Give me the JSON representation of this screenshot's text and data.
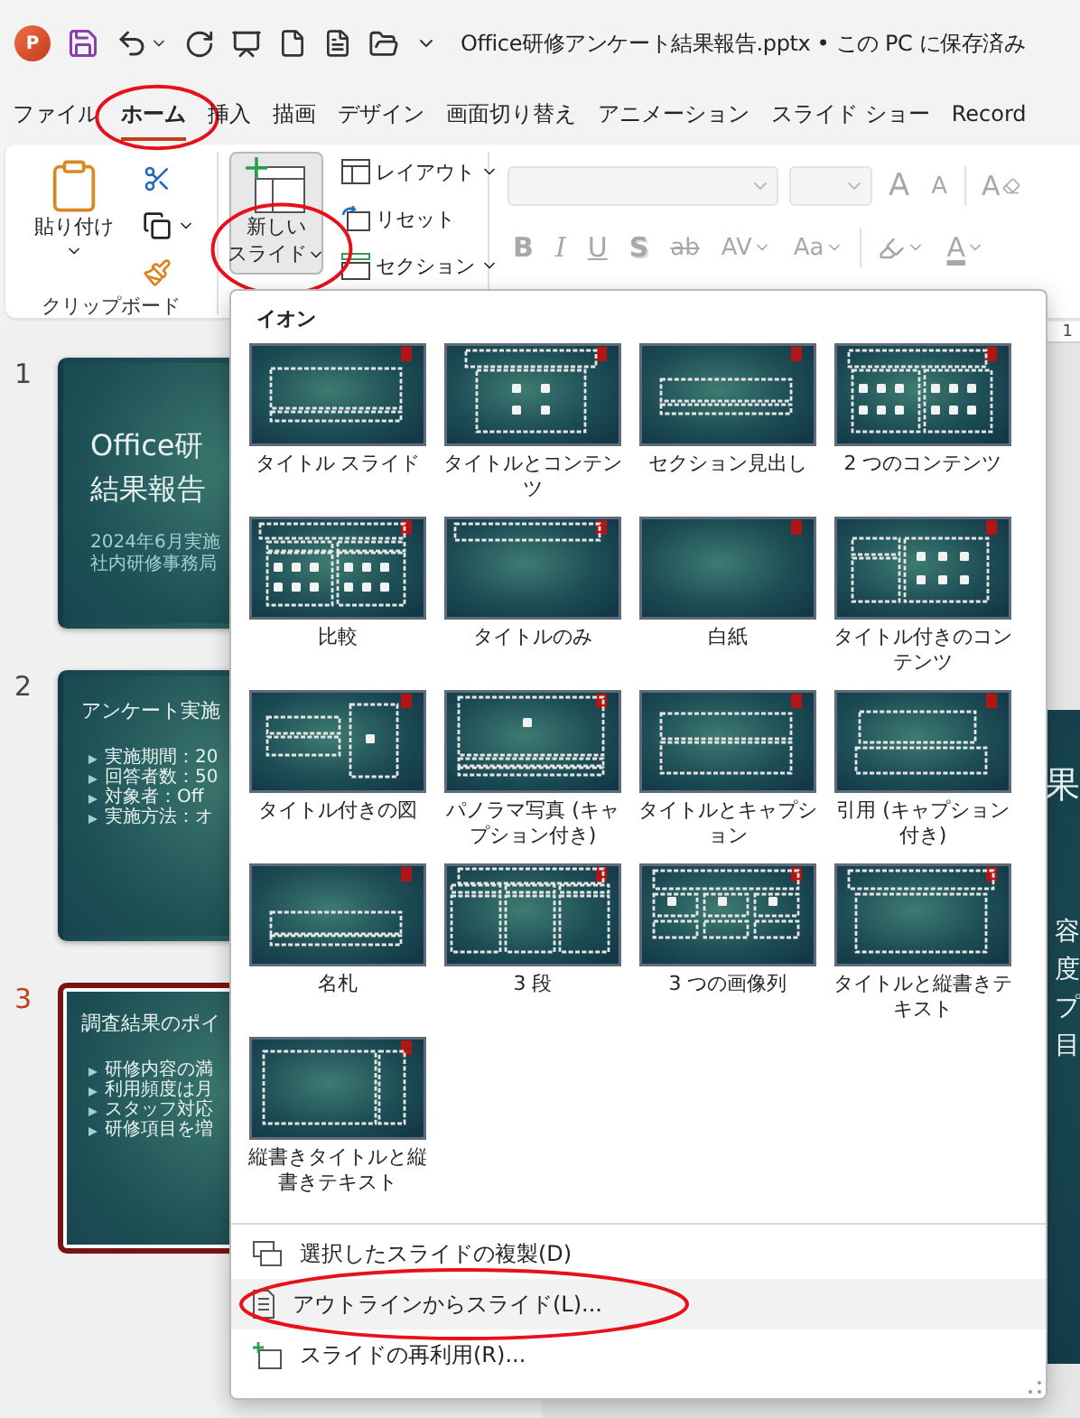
{
  "app_icon_letter": "P",
  "window": {
    "title": "Office研修アンケート結果報告.pptx • この PC に保存済み"
  },
  "tabs": [
    {
      "label": "ファイル",
      "selected": false,
      "circled": false
    },
    {
      "label": "ホーム",
      "selected": true,
      "circled": true
    },
    {
      "label": "挿入",
      "selected": false,
      "circled": false
    },
    {
      "label": "描画",
      "selected": false,
      "circled": false
    },
    {
      "label": "デザイン",
      "selected": false,
      "circled": false
    },
    {
      "label": "画面切り替え",
      "selected": false,
      "circled": false
    },
    {
      "label": "アニメーション",
      "selected": false,
      "circled": false
    },
    {
      "label": "スライド ショー",
      "selected": false,
      "circled": false
    },
    {
      "label": "Record",
      "selected": false,
      "circled": false
    }
  ],
  "clipboard": {
    "paste": "貼り付け",
    "label": "クリップボード"
  },
  "slides_group": {
    "new_slide": {
      "label_lines": [
        "新しい",
        "スライド"
      ],
      "pressed": true,
      "circled": true
    },
    "commands": [
      {
        "label": "レイアウト",
        "kind": "layout"
      },
      {
        "label": "リセット",
        "kind": "reset"
      },
      {
        "label": "セクション",
        "kind": "section"
      }
    ]
  },
  "font_group": {
    "disabled": true,
    "row1": [
      {
        "kind": "font"
      },
      {
        "kind": "size"
      },
      {
        "kind": "grow",
        "text": "A"
      },
      {
        "kind": "shrink",
        "text": "A"
      },
      {
        "kind": "clear",
        "text": "A"
      }
    ],
    "row2": [
      {
        "kind": "bold",
        "text": "B"
      },
      {
        "kind": "italic",
        "text": "I"
      },
      {
        "kind": "underline",
        "text": "U"
      },
      {
        "kind": "shadow",
        "text": "S"
      },
      {
        "kind": "strike",
        "text": "ab"
      },
      {
        "kind": "spacing",
        "text": "AV"
      },
      {
        "kind": "case",
        "text": "Aa"
      },
      {
        "kind": "highlight"
      },
      {
        "kind": "color",
        "text": "A"
      }
    ]
  },
  "slides": [
    {
      "number": "1",
      "selected": false,
      "kind": "title",
      "title_lines": [
        "Office研",
        "結果報告"
      ],
      "subtitle_lines": [
        "2024年6月実施",
        "社内研修事務局"
      ]
    },
    {
      "number": "2",
      "selected": false,
      "kind": "bullets",
      "title_lines": [
        "アンケート実施"
      ],
      "bullets": [
        "実施期間：20",
        "回答者数：50",
        "対象者：Off",
        "実施方法：オ"
      ]
    },
    {
      "number": "3",
      "selected": true,
      "kind": "bullets",
      "title_lines": [
        "調査結果のポイ"
      ],
      "bullets": [
        "研修内容の満",
        "利用頻度は月",
        "スタッフ対応",
        "研修項目を増"
      ]
    }
  ],
  "editor": {
    "ruler_label": "1",
    "slide_title": "果",
    "bullets": [
      "容",
      "度",
      "プ",
      "目"
    ]
  },
  "layout_menu": {
    "heading": "イオン",
    "layouts": [
      {
        "label": "タイトル スライド",
        "kind": "title"
      },
      {
        "label": "タイトルとコンテンツ",
        "kind": "content"
      },
      {
        "label": "セクション見出し",
        "kind": "section"
      },
      {
        "label": "2 つのコンテンツ",
        "kind": "two"
      },
      {
        "label": "比較",
        "kind": "compare"
      },
      {
        "label": "タイトルのみ",
        "kind": "titleonly"
      },
      {
        "label": "白紙",
        "kind": "blank"
      },
      {
        "label": "タイトル付きのコンテンツ",
        "kind": "contentcap"
      },
      {
        "label": "タイトル付きの図",
        "kind": "picturecap"
      },
      {
        "label": "パノラマ写真 (キャプション付き)",
        "kind": "panorama"
      },
      {
        "label": "タイトルとキャプション",
        "kind": "caption"
      },
      {
        "label": "引用 (キャプション付き)",
        "kind": "quote"
      },
      {
        "label": "名札",
        "kind": "namecard"
      },
      {
        "label": "3 段",
        "kind": "threecol"
      },
      {
        "label": "3 つの画像列",
        "kind": "threepic"
      },
      {
        "label": "タイトルと縦書きテキスト",
        "kind": "verttext"
      },
      {
        "label": "縦書きタイトルと縦書きテキスト",
        "kind": "vertboth"
      }
    ],
    "items": [
      {
        "label": "選択したスライドの複製(D)",
        "kind": "duplicate",
        "highlighted": false,
        "circled": false
      },
      {
        "label": "アウトラインからスライド(L)...",
        "kind": "outline",
        "highlighted": true,
        "circled": true
      },
      {
        "label": "スライドの再利用(R)...",
        "kind": "reuse",
        "highlighted": false,
        "circled": false
      }
    ]
  }
}
